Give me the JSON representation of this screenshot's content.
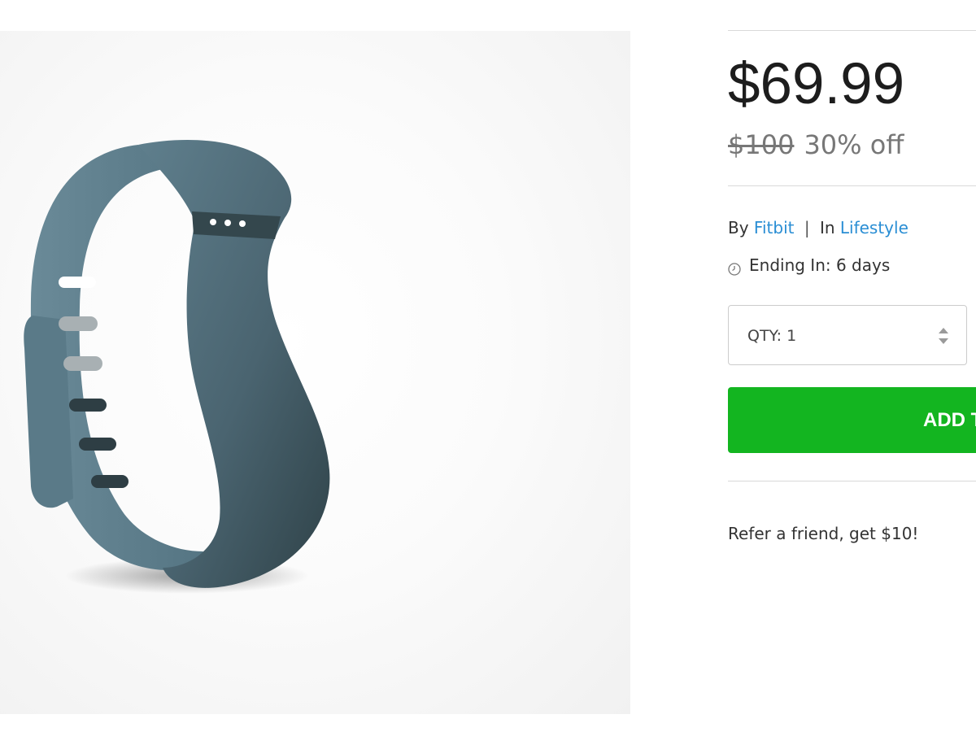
{
  "product": {
    "image_alt": "Fitbit Flex wristband in slate blue",
    "image_icon": "product-photo",
    "band_color": "#4e6875"
  },
  "pricing": {
    "price": "$69.99",
    "original_price": "$100",
    "discount": "30% off"
  },
  "meta": {
    "by_label": "By",
    "brand": "Fitbit",
    "separator": "|",
    "in_label": "In",
    "category": "Lifestyle",
    "link_color": "#2a8ed4"
  },
  "ending": {
    "icon": "clock-icon",
    "text": "Ending In: 6 days"
  },
  "quantity": {
    "label": "QTY: 1",
    "icon": "stepper-icon"
  },
  "cart": {
    "button_label": "ADD T",
    "button_color": "#13b520"
  },
  "refer": {
    "text": "Refer a friend, get $10!"
  }
}
